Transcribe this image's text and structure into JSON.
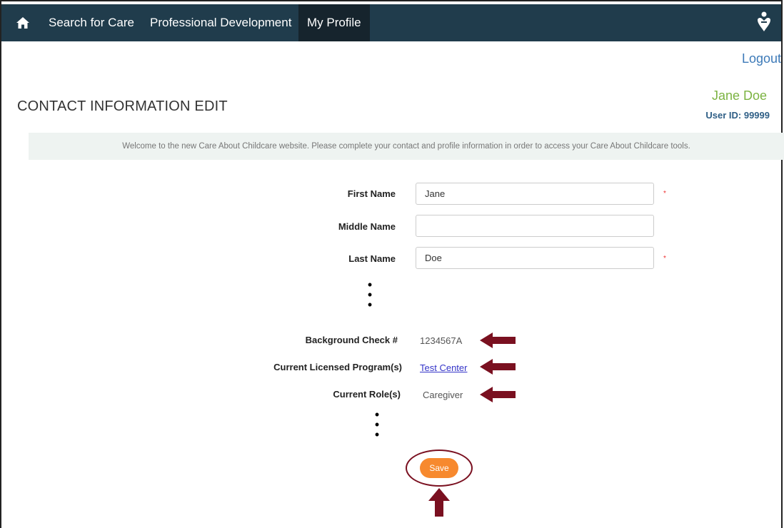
{
  "nav": {
    "items": [
      "Search for Care",
      "Professional Development",
      "My Profile"
    ],
    "active": "My Profile"
  },
  "header": {
    "logout": "Logout",
    "title": "CONTACT INFORMATION EDIT",
    "user_name": "Jane Doe",
    "user_id": "User ID: 99999"
  },
  "welcome": "Welcome to the new Care About Childcare website. Please complete your contact and profile information in order to access your Care About Childcare tools.",
  "form": {
    "first_name": {
      "label": "First Name",
      "value": "Jane"
    },
    "middle_name": {
      "label": "Middle Name",
      "value": ""
    },
    "last_name": {
      "label": "Last Name",
      "value": "Doe"
    },
    "required_mark": "*",
    "background_check": {
      "label": "Background Check #",
      "value": "1234567A"
    },
    "licensed_programs": {
      "label": "Current Licensed Program(s)",
      "value": "Test Center"
    },
    "roles": {
      "label": "Current Role(s)",
      "value": "Caregiver"
    },
    "save": "Save"
  },
  "colors": {
    "nav_bg": "#203c4c",
    "accent_green": "#7cb342",
    "save_orange": "#f7892e",
    "annotation_red": "#7a1020"
  }
}
